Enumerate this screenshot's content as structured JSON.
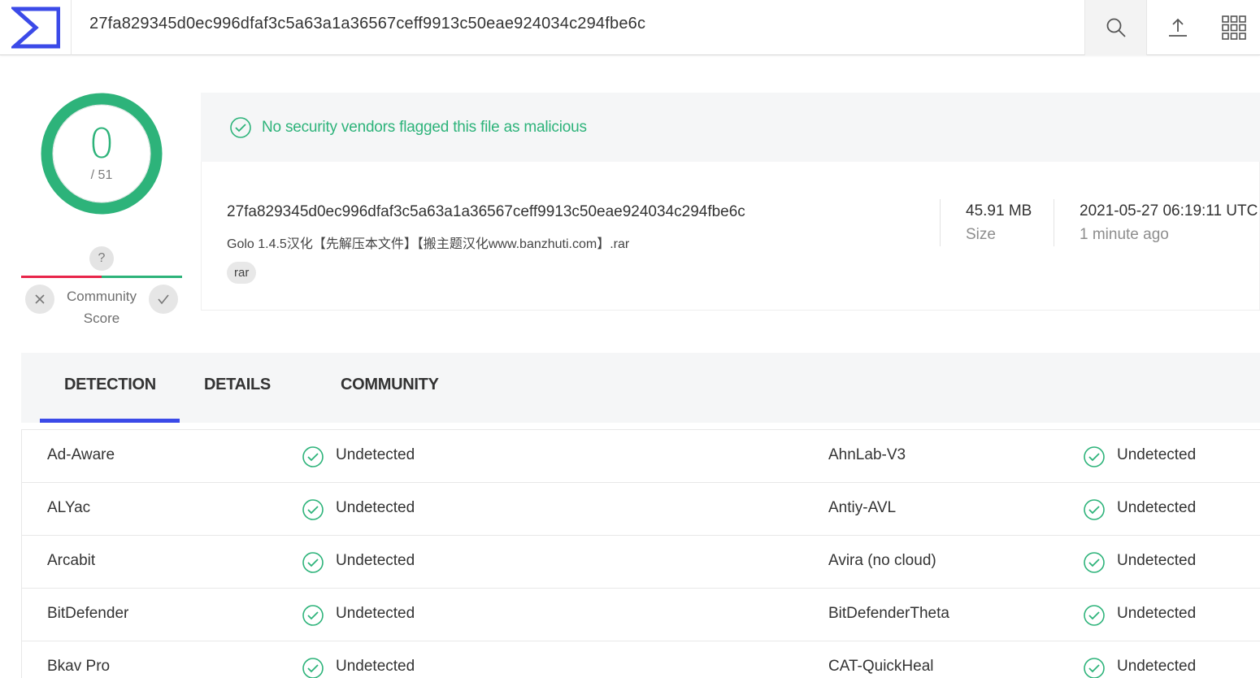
{
  "header": {
    "search_value": "27fa829345d0ec996dfaf3c5a63a1a36567ceff9913c50eae924034c294fbe6c"
  },
  "icons": {
    "logo": "virustotal-sigma-logo",
    "search": "search-icon",
    "upload": "upload-icon",
    "apps": "apps-grid-icon",
    "ok": "check-circle-icon"
  },
  "colors": {
    "accent_green": "#2db37a",
    "accent_red": "#e8254a",
    "accent_blue": "#3b4ae8"
  },
  "score": {
    "detections": "0",
    "total": "/ 51"
  },
  "community": {
    "unknown_glyph": "?",
    "label": "Community Score",
    "level": 0.5
  },
  "banner": {
    "message": "No security vendors flagged this file as malicious"
  },
  "file": {
    "hash": "27fa829345d0ec996dfaf3c5a63a1a36567ceff9913c50eae924034c294fbe6c",
    "name": "Golo 1.4.5汉化【先解压本文件】【搬主题汉化www.banzhuti.com】.rar",
    "tag": "rar",
    "size": "45.91 MB",
    "size_label": "Size",
    "date": "2021-05-27 06:19:11 UTC",
    "date_relative": "1 minute ago"
  },
  "tabs": [
    {
      "label": "DETECTION",
      "active": true
    },
    {
      "label": "DETAILS",
      "active": false
    },
    {
      "label": "COMMUNITY",
      "active": false
    }
  ],
  "results": [
    {
      "left": {
        "engine": "Ad-Aware",
        "result": "Undetected"
      },
      "right": {
        "engine": "AhnLab-V3",
        "result": "Undetected"
      }
    },
    {
      "left": {
        "engine": "ALYac",
        "result": "Undetected"
      },
      "right": {
        "engine": "Antiy-AVL",
        "result": "Undetected"
      }
    },
    {
      "left": {
        "engine": "Arcabit",
        "result": "Undetected"
      },
      "right": {
        "engine": "Avira (no cloud)",
        "result": "Undetected"
      }
    },
    {
      "left": {
        "engine": "BitDefender",
        "result": "Undetected"
      },
      "right": {
        "engine": "BitDefenderTheta",
        "result": "Undetected"
      }
    },
    {
      "left": {
        "engine": "Bkav Pro",
        "result": "Undetected"
      },
      "right": {
        "engine": "CAT-QuickHeal",
        "result": "Undetected"
      }
    }
  ]
}
